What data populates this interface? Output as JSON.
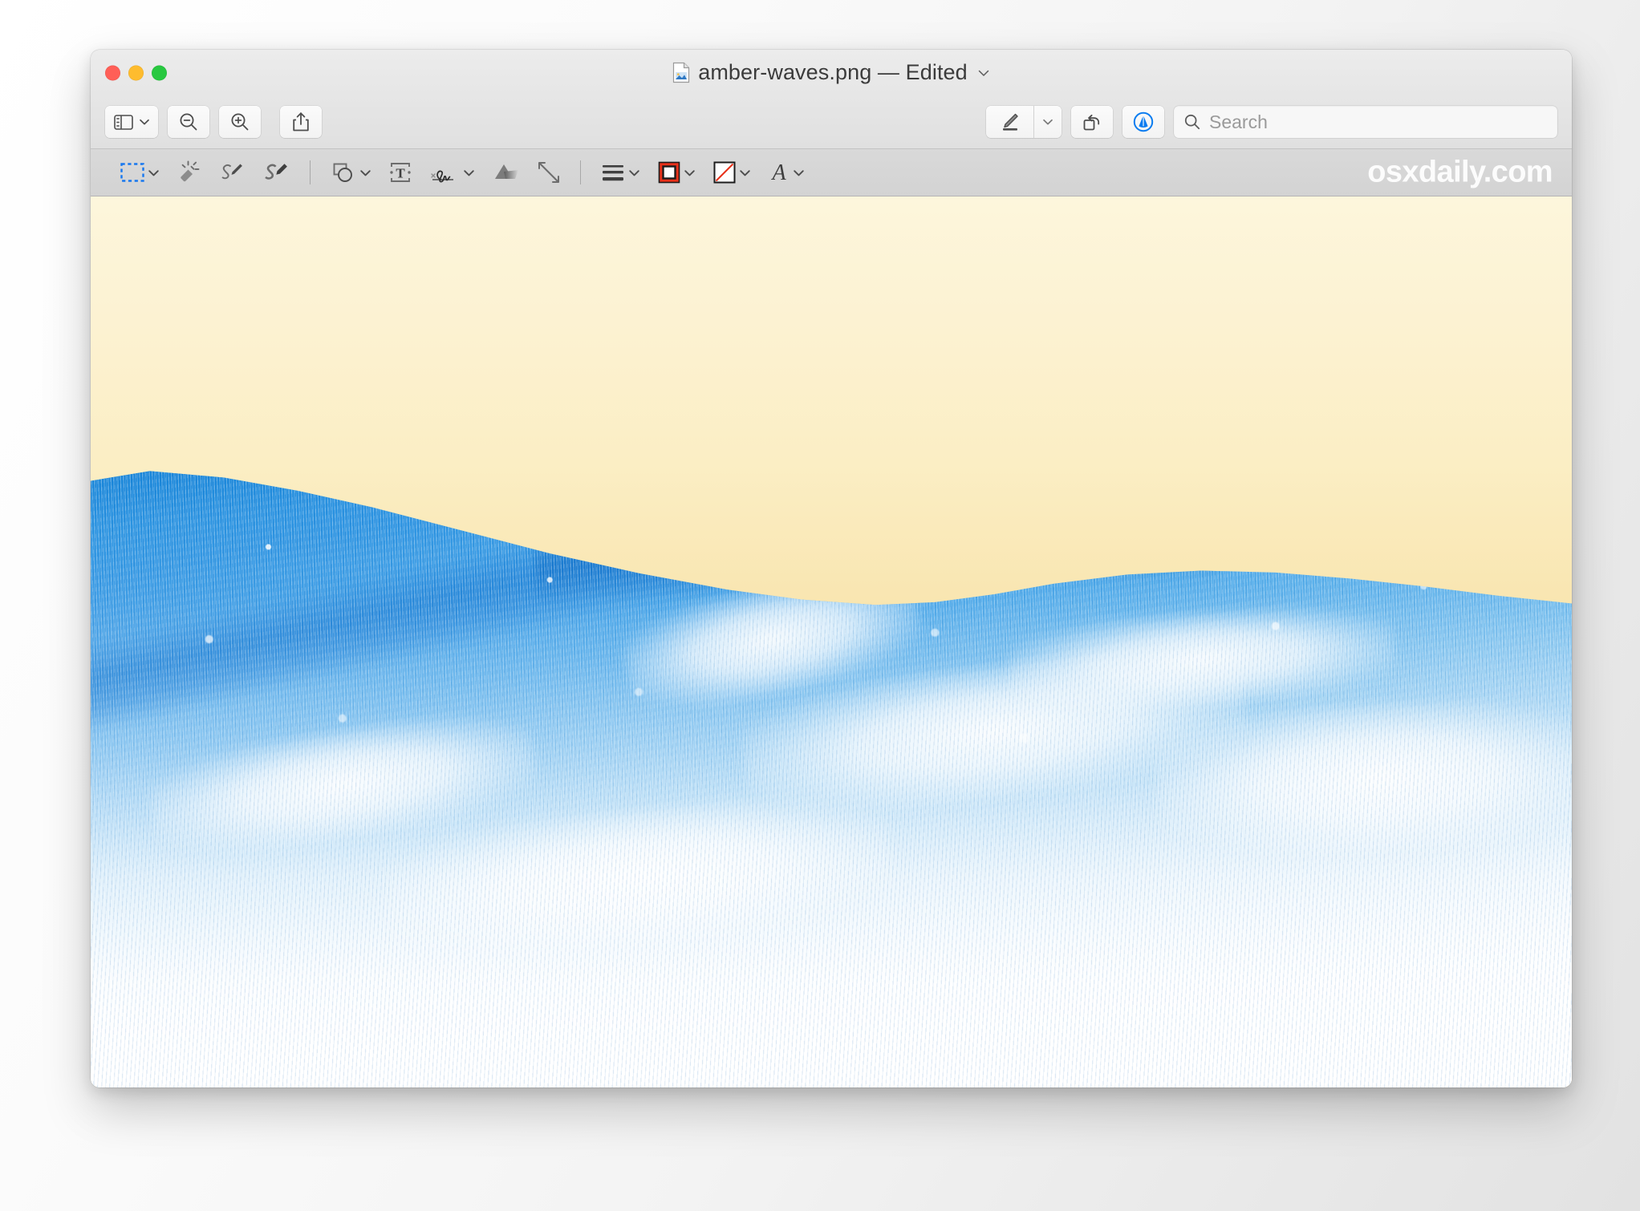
{
  "window": {
    "title": "amber-waves.png — Edited",
    "title_filename": "amber-waves.png",
    "title_status": "Edited",
    "traffic_lights": [
      {
        "name": "close",
        "color": "#ff5f57"
      },
      {
        "name": "minimize",
        "color": "#febc2e"
      },
      {
        "name": "zoom",
        "color": "#28c840"
      }
    ],
    "doc_icon": "preview-document-icon",
    "title_chevron": "chevron-down-icon"
  },
  "toolbar": {
    "left_buttons": [
      {
        "label": "",
        "icon": "sidebar-icon",
        "name": "sidebar-toggle-button",
        "has_chevron": true
      },
      {
        "label": "",
        "icon": "zoom-out-icon",
        "name": "zoom-out-button",
        "has_chevron": false
      },
      {
        "label": "",
        "icon": "zoom-in-icon",
        "name": "zoom-in-button",
        "has_chevron": false
      },
      {
        "label": "",
        "icon": "share-icon",
        "name": "share-button",
        "has_chevron": false
      }
    ],
    "right_buttons": [
      {
        "label": "",
        "icon": "markup-highlight-icon",
        "name": "markup-highlight-button",
        "has_chevron": true
      },
      {
        "label": "",
        "icon": "rotate-left-icon",
        "name": "rotate-button",
        "has_chevron": false
      },
      {
        "label": "",
        "icon": "markup-toolbar-icon",
        "name": "show-markup-toolbar-button",
        "has_chevron": false,
        "active": true,
        "accent": "#0a7cf0"
      }
    ],
    "search": {
      "icon": "search-icon",
      "placeholder": "Search",
      "value": ""
    }
  },
  "markup_toolbar": {
    "items": [
      {
        "icon": "selection-tool-icon",
        "name": "selection-tool",
        "has_chevron": true,
        "accent": "#1677ef"
      },
      {
        "icon": "instant-alpha-icon",
        "name": "instant-alpha-tool",
        "has_chevron": false
      },
      {
        "icon": "sketch-icon",
        "name": "sketch-tool",
        "has_chevron": false
      },
      {
        "icon": "draw-icon",
        "name": "draw-tool",
        "has_chevron": false
      },
      {
        "icon": "separator",
        "name": "toolbar-separator-1",
        "has_chevron": false
      },
      {
        "icon": "shapes-icon",
        "name": "shapes-tool",
        "has_chevron": true
      },
      {
        "icon": "text-tool-icon",
        "name": "text-tool",
        "has_chevron": false
      },
      {
        "icon": "signature-icon",
        "name": "signature-tool",
        "has_chevron": true
      },
      {
        "icon": "adjust-color-icon",
        "name": "adjust-color-tool",
        "has_chevron": false
      },
      {
        "icon": "adjust-size-icon",
        "name": "adjust-size-tool",
        "has_chevron": false
      },
      {
        "icon": "separator",
        "name": "toolbar-separator-2",
        "has_chevron": false
      },
      {
        "icon": "shape-style-icon",
        "name": "shape-style-tool",
        "has_chevron": true
      },
      {
        "icon": "border-color-icon",
        "name": "border-color-tool",
        "has_chevron": true,
        "accent": "#e8311a"
      },
      {
        "icon": "fill-color-icon",
        "name": "fill-color-tool",
        "has_chevron": true,
        "accent": "#e8311a"
      },
      {
        "icon": "text-style-icon",
        "name": "text-style-tool",
        "has_chevron": true,
        "label": "A"
      }
    ],
    "watermark": "osxdaily.com"
  },
  "image": {
    "name": "amber-waves-image",
    "sky_top_color": "#fdf6dc",
    "sky_bottom_color": "#edb545",
    "field_color": "#1f8fe0",
    "field_highlight_color": "#ffffff"
  }
}
